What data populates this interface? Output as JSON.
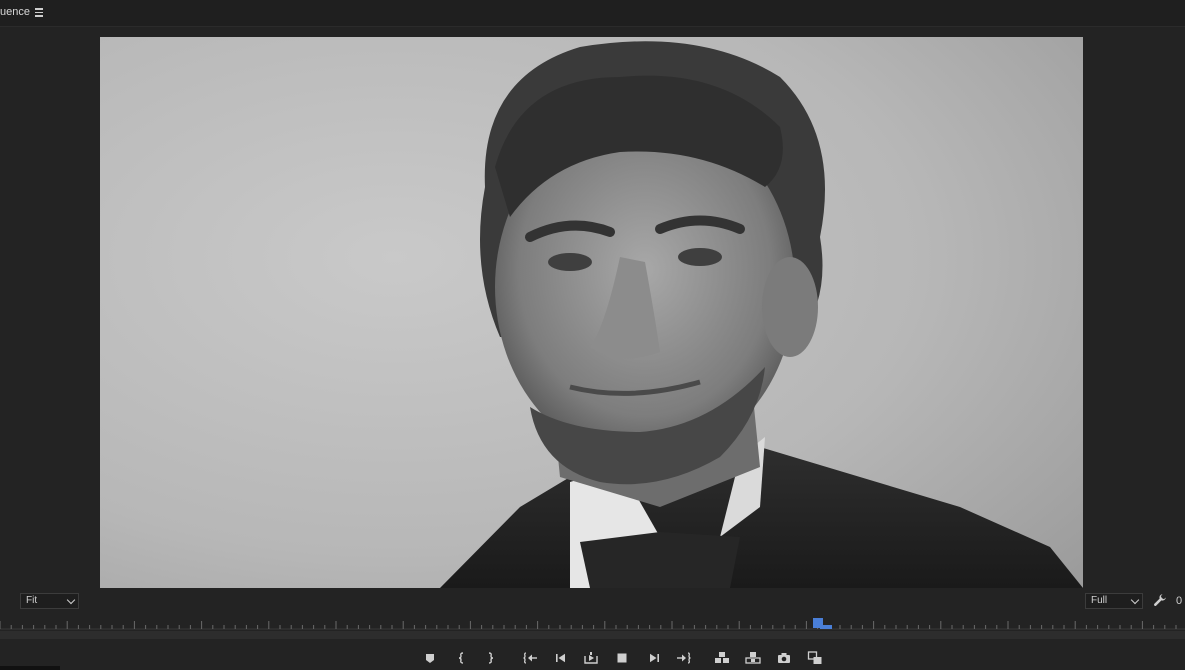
{
  "panel": {
    "title": "uence",
    "menu_icon": "hamburger-menu-icon"
  },
  "viewer": {
    "content": "Black and white portrait photograph"
  },
  "controls": {
    "zoom_select": {
      "value": "Fit"
    },
    "resolution_select": {
      "value": "Full"
    },
    "settings_icon": "wrench-icon",
    "timecode_partial": "0"
  },
  "playhead": {
    "position_fraction": 0.69,
    "color": "#4a7fd8"
  },
  "transport": {
    "buttons": [
      {
        "name": "add-marker-button",
        "icon": "marker-icon"
      },
      {
        "name": "mark-in-button",
        "icon": "mark-in-icon"
      },
      {
        "name": "mark-out-button",
        "icon": "mark-out-icon"
      },
      {
        "name": "go-to-in-button",
        "icon": "go-to-in-icon"
      },
      {
        "name": "step-back-button",
        "icon": "step-back-icon"
      },
      {
        "name": "play-in-to-out-button",
        "icon": "loop-icon"
      },
      {
        "name": "stop-button",
        "icon": "stop-icon"
      },
      {
        "name": "step-forward-button",
        "icon": "step-forward-icon"
      },
      {
        "name": "go-to-out-button",
        "icon": "go-to-out-icon"
      },
      {
        "name": "insert-button",
        "icon": "insert-icon"
      },
      {
        "name": "overwrite-button",
        "icon": "overwrite-icon"
      },
      {
        "name": "export-frame-button",
        "icon": "camera-icon"
      },
      {
        "name": "compare-view-button",
        "icon": "compare-icon"
      }
    ]
  },
  "colors": {
    "background": "#232323",
    "accent": "#4a7fd8"
  }
}
